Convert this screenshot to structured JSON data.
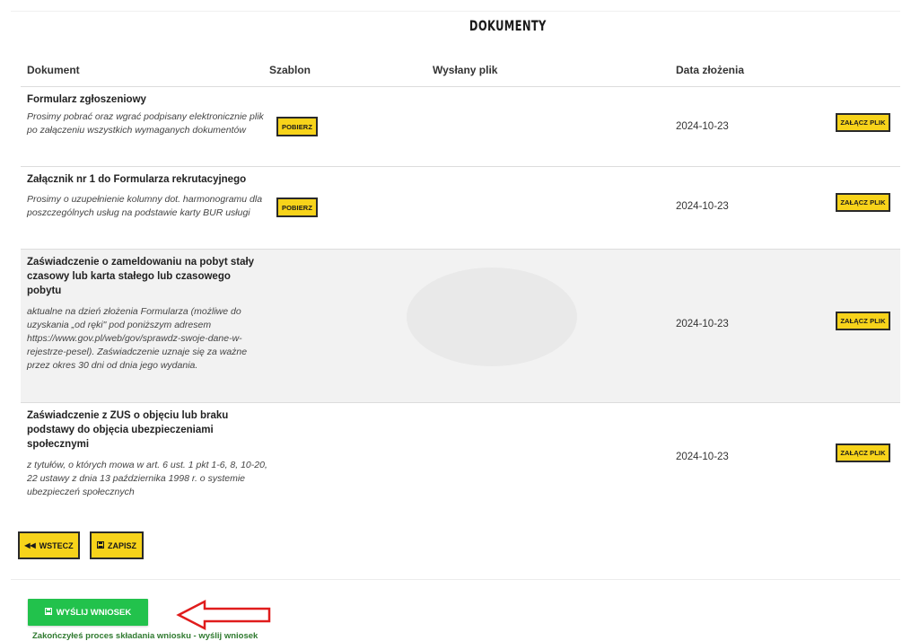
{
  "page": {
    "title": "DOKUMENTY"
  },
  "table": {
    "headers": {
      "document": "Dokument",
      "template": "Szablon",
      "sent_file": "Wysłany plik",
      "date": "Data złożenia"
    },
    "rows": [
      {
        "title": "Formularz zgłoszeniowy",
        "description": "Prosimy pobrać oraz wgrać podpisany elektronicznie plik po załączeniu wszystkich wymaganych dokumentów",
        "template_button": "POBIERZ",
        "date": "2024-10-23",
        "attach_button": "ZAŁĄCZ PLIK"
      },
      {
        "title": "Załącznik nr 1 do Formularza rekrutacyjnego",
        "description": "Prosimy o uzupełnienie kolumny dot. harmonogramu dla poszczególnych usług na podstawie karty BUR usługi",
        "template_button": "POBIERZ",
        "date": "2024-10-23",
        "attach_button": "ZAŁĄCZ PLIK"
      },
      {
        "title": "Zaświadczenie o zameldowaniu na pobyt stały czasowy lub karta stałego lub czasowego pobytu",
        "description": "aktualne na dzień złożenia Formularza (możliwe do uzyskania „od ręki\" pod poniższym adresem https://www.gov.pl/web/gov/sprawdz-swoje-dane-w-rejestrze-pesel). Zaświadczenie uznaje się za ważne przez okres 30 dni od dnia jego wydania.",
        "date": "2024-10-23",
        "attach_button": "ZAŁĄCZ PLIK"
      },
      {
        "title": "Zaświadczenie z ZUS o objęciu lub braku podstawy do objęcia ubezpieczeniami społecznymi",
        "description": "z tytułów, o których mowa w art. 6 ust. 1 pkt 1-6, 8, 10-20, 22 ustawy z dnia 13 października 1998 r. o systemie ubezpieczeń społecznych",
        "date": "2024-10-23",
        "attach_button": "ZAŁĄCZ PLIK"
      }
    ]
  },
  "actions": {
    "back_label": "WSTECZ",
    "save_label": "ZAPISZ"
  },
  "submit": {
    "label": "WYŚLIJ WNIOSEK",
    "note": "Zakończyłeś proces składania wniosku - wyślij wniosek"
  },
  "icons": {
    "back": "double-chevron-left-icon",
    "save": "floppy-disk-icon",
    "arrow": "left-arrow-outline-icon"
  },
  "colors": {
    "accent_yellow": "#f7d31a",
    "submit_green": "#22c24c",
    "arrow_red": "#e01c1c",
    "note_green": "#2f7a2f"
  }
}
